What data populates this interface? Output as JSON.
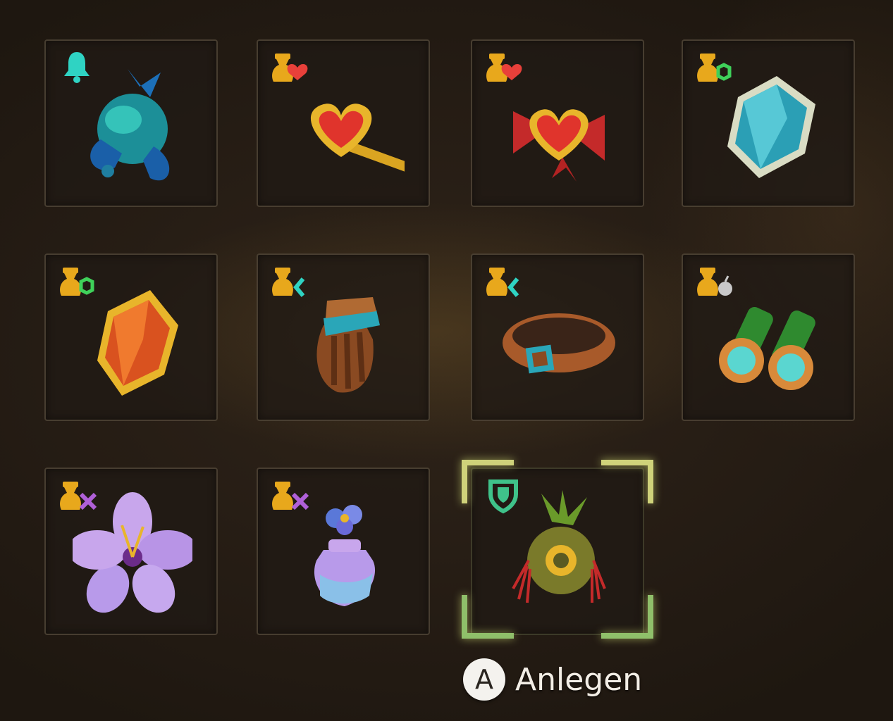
{
  "inventory": {
    "items": [
      {
        "icon": "blue-bird-ornament-icon",
        "badge": "bell-icon",
        "badge_color": "#2fd3c3"
      },
      {
        "icon": "heart-key-icon",
        "badge": "pouch-heart-icon",
        "badge_color": "#e8a81c"
      },
      {
        "icon": "heart-bow-icon",
        "badge": "pouch-heart-icon",
        "badge_color": "#e8a81c"
      },
      {
        "icon": "blue-gem-icon",
        "badge": "pouch-ring-icon",
        "badge_color": "#e8a81c"
      },
      {
        "icon": "orange-gem-icon",
        "badge": "pouch-ring-icon",
        "badge_color": "#e8a81c"
      },
      {
        "icon": "leather-glove-icon",
        "badge": "pouch-chevron-icon",
        "badge_color": "#e8a81c"
      },
      {
        "icon": "leather-belt-icon",
        "badge": "pouch-chevron-icon",
        "badge_color": "#e8a81c"
      },
      {
        "icon": "binoculars-icon",
        "badge": "pouch-apple-icon",
        "badge_color": "#e8a81c"
      },
      {
        "icon": "lilac-flower-icon",
        "badge": "pouch-swords-icon",
        "badge_color": "#e8a81c"
      },
      {
        "icon": "flower-potion-icon",
        "badge": "pouch-swords-icon",
        "badge_color": "#e8a81c"
      },
      {
        "icon": "leaf-amulet-icon",
        "badge": "shield-icon",
        "badge_color": "#3fc28a",
        "selected": true
      }
    ]
  },
  "prompt": {
    "button": "A",
    "label": "Anlegen"
  },
  "colors": {
    "selection_top": "#cfd27a",
    "selection_bottom": "#8fbf6a",
    "badge_gold": "#e8a81c",
    "badge_teal": "#2fd3c3",
    "badge_green": "#3fc28a"
  }
}
